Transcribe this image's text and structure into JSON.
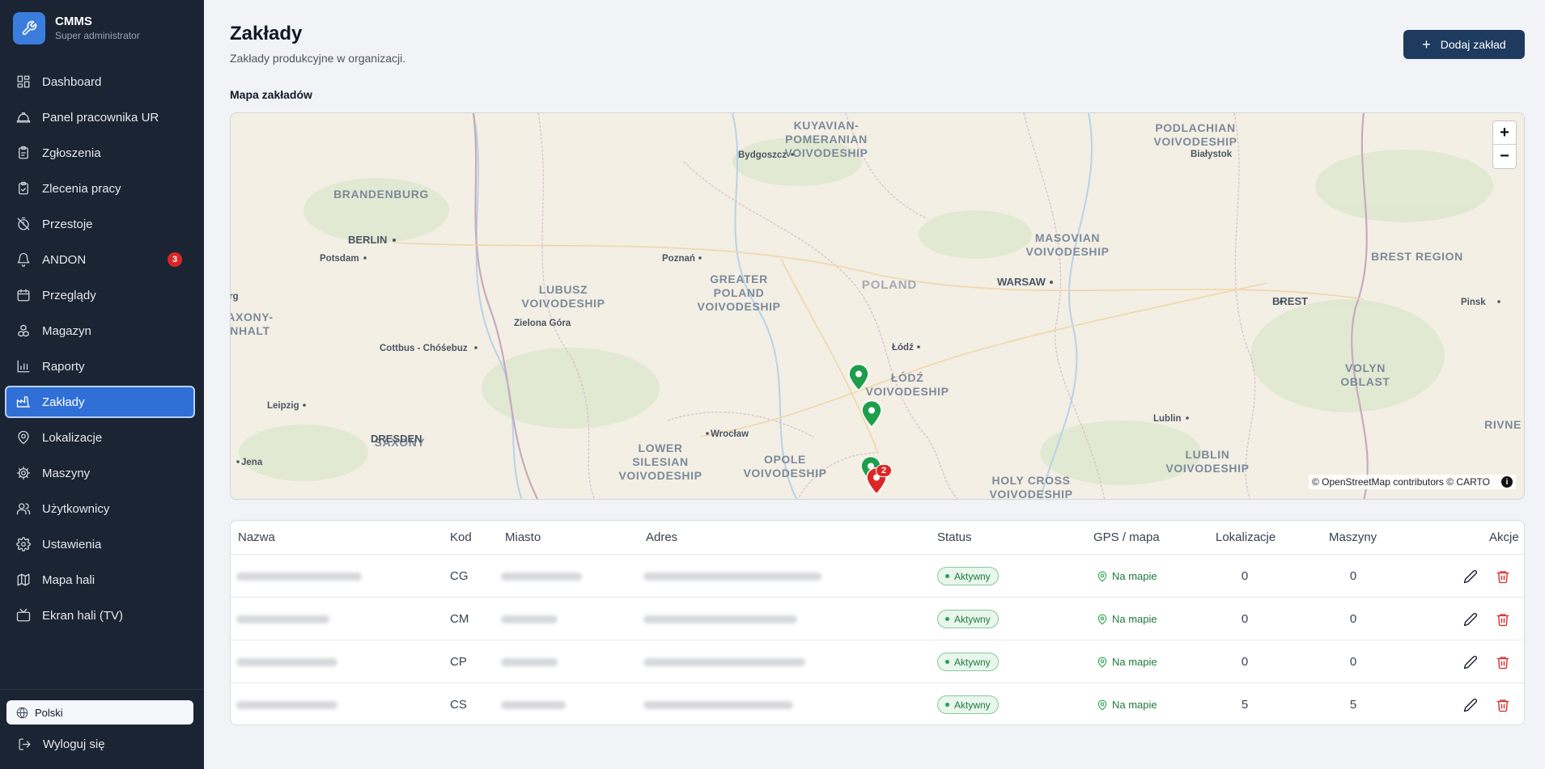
{
  "app": {
    "title": "CMMS",
    "role": "Super administrator"
  },
  "sidebar": {
    "items": [
      {
        "label": "Dashboard",
        "icon": "dashboard-icon",
        "active": false
      },
      {
        "label": "Panel pracownika UR",
        "icon": "hard-hat-icon",
        "active": false
      },
      {
        "label": "Zgłoszenia",
        "icon": "clipboard-icon",
        "active": false
      },
      {
        "label": "Zlecenia pracy",
        "icon": "clipboard-check-icon",
        "active": false
      },
      {
        "label": "Przestoje",
        "icon": "timer-off-icon",
        "active": false
      },
      {
        "label": "ANDON",
        "icon": "bell-icon",
        "active": false,
        "badge": "3"
      },
      {
        "label": "Przeglądy",
        "icon": "calendar-icon",
        "active": false
      },
      {
        "label": "Magazyn",
        "icon": "boxes-icon",
        "active": false
      },
      {
        "label": "Raporty",
        "icon": "bar-chart-icon",
        "active": false
      },
      {
        "label": "Zakłady",
        "icon": "factory-icon",
        "active": true
      },
      {
        "label": "Lokalizacje",
        "icon": "map-pin-icon",
        "active": false
      },
      {
        "label": "Maszyny",
        "icon": "cog-icon",
        "active": false
      },
      {
        "label": "Użytkownicy",
        "icon": "users-icon",
        "active": false
      },
      {
        "label": "Ustawienia",
        "icon": "settings-icon",
        "active": false
      },
      {
        "label": "Mapa hali",
        "icon": "map-icon",
        "active": false
      },
      {
        "label": "Ekran hali (TV)",
        "icon": "tv-icon",
        "active": false
      }
    ],
    "language": "Polski",
    "logout": "Wyloguj się"
  },
  "header": {
    "title": "Zakłady",
    "subtitle": "Zakłady produkcyjne w organizacji.",
    "add_button": "Dodaj zakład"
  },
  "map": {
    "label": "Mapa zakładów",
    "attribution": "© OpenStreetMap contributors © CARTO",
    "zoom_in": "+",
    "zoom_out": "−",
    "cluster_count": "2",
    "place_labels": [
      "KUYAVIAN-",
      "POMERANIAN",
      "VOIVODESHIP",
      "Bydgoszcz",
      "PODLACHIAN",
      "VOIVODESHIP",
      "Białystok",
      "BRANDENBURG",
      "BERLIN",
      "Potsdam",
      "Poznań",
      "MASOVIAN",
      "VOIVODESHIP",
      "BREST REGION",
      "LUBUSZ",
      "VOIVODESHIP",
      "GREATER",
      "POLAND",
      "VOIVODESHIP",
      "POLAND",
      "WARSAW",
      "Zielona Góra",
      "BREST",
      "Pinsk",
      "AXONY-",
      "NHALT",
      "Cottbus - Chóśebuz",
      "Łódź",
      "ŁÓDŹ",
      "VOIVODESHIP",
      "VOLYN",
      "OBLAST",
      "Leipzig",
      "Lublin",
      "RIVNE O",
      "DRESDEN",
      "SAXONY",
      "Wrocław",
      "LOWER",
      "SILESIAN",
      "VOIVODESHIP",
      "OPOLE",
      "VOIVODESHIP",
      "LUBLIN",
      "VOIVODESHIP",
      "HOLY CROSS",
      "VOIVODESHIP",
      "Jena",
      "rg"
    ]
  },
  "table": {
    "columns": [
      "Nazwa",
      "Kod",
      "Miasto",
      "Adres",
      "Status",
      "GPS / mapa",
      "Lokalizacje",
      "Maszyny",
      "Akcje"
    ],
    "rows": [
      {
        "code": "CG",
        "status": "Aktywny",
        "gps": "Na mapie",
        "locations": "0",
        "machines": "0"
      },
      {
        "code": "CM",
        "status": "Aktywny",
        "gps": "Na mapie",
        "locations": "0",
        "machines": "0"
      },
      {
        "code": "CP",
        "status": "Aktywny",
        "gps": "Na mapie",
        "locations": "0",
        "machines": "0"
      },
      {
        "code": "CS",
        "status": "Aktywny",
        "gps": "Na mapie",
        "locations": "5",
        "machines": "5"
      }
    ]
  },
  "colors": {
    "sidebar_bg": "#1b2432",
    "accent": "#2f6fd6",
    "primary_button": "#1e3a5f",
    "status_green": "#22a34a",
    "danger": "#dc2626"
  }
}
